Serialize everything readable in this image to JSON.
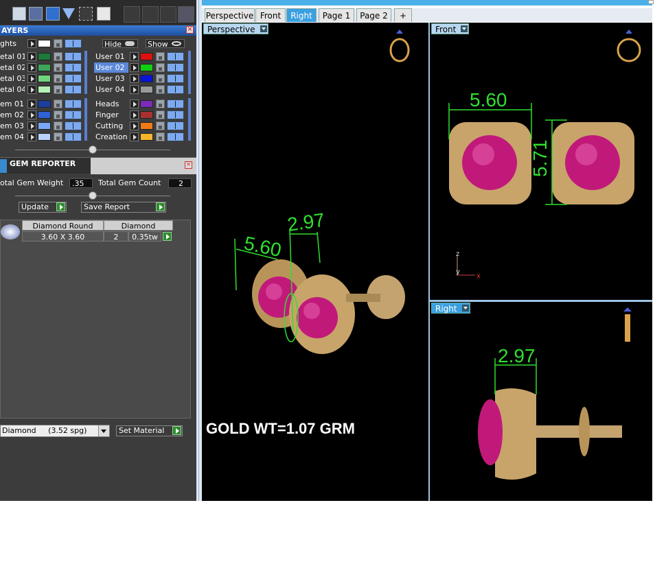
{
  "layers": {
    "title": "AYERS",
    "hide_label": "Hide",
    "show_label": "Show",
    "lights_label": "ghts",
    "left_rows": [
      {
        "name": "etal 01",
        "color": "#1d7a3a"
      },
      {
        "name": "etal 02",
        "color": "#3fa55a"
      },
      {
        "name": "etal 03",
        "color": "#6ed47e"
      },
      {
        "name": "etal 04",
        "color": "#b5f0b5"
      },
      {
        "name": "em 01",
        "color": "#1a3fa0"
      },
      {
        "name": "em 02",
        "color": "#2f62d8"
      },
      {
        "name": "em 03",
        "color": "#78a8f5"
      },
      {
        "name": "em 04",
        "color": "#b9d2fb"
      }
    ],
    "right_rows": [
      {
        "name": "User 01",
        "color": "#e01010"
      },
      {
        "name": "User 02",
        "color": "#10d010",
        "selected": true
      },
      {
        "name": "User 03",
        "color": "#0a14d8"
      },
      {
        "name": "User 04",
        "color": "#9a9a9a"
      },
      {
        "name": "Heads",
        "color": "#7b2bb8"
      },
      {
        "name": "Finger",
        "color": "#a83030"
      },
      {
        "name": "Cutting",
        "color": "#f07a16"
      },
      {
        "name": "Creation",
        "color": "#f5b52a"
      }
    ]
  },
  "gem_reporter": {
    "title": "GEM REPORTER",
    "total_weight_label": "otal Gem Weight",
    "total_weight_value": ".35",
    "total_count_label": "Total Gem Count",
    "total_count_value": "2",
    "update_label": "Update",
    "save_report_label": "Save Report",
    "table_headers": [
      "Diamond Round",
      "Diamond"
    ],
    "row": {
      "size": "3.60 X 3.60",
      "count": "2",
      "weight": "0.35tw"
    },
    "material_select": "Diamond     (3.52 spg)",
    "set_material_label": "Set Material"
  },
  "tabs": [
    "Perspective",
    "Front",
    "Right",
    "Page 1",
    "Page 2",
    "+"
  ],
  "active_tab": "Right",
  "viewports": {
    "perspective_label": "Perspective",
    "front_label": "Front",
    "right_label": "Right"
  },
  "dimensions": {
    "persp_width": "5.60",
    "persp_depth": "2.97",
    "front_width": "5.60",
    "front_height": "5.71",
    "right_depth": "2.97"
  },
  "axis": {
    "z": "z",
    "y": "y",
    "x": "x"
  },
  "gold_weight": "GOLD WT=1.07 GRM",
  "colors": {
    "dim_green": "#2fe02f",
    "gold": "#d9b97a",
    "ruby": "#c1197a",
    "accent_blue": "#3aa0e0"
  }
}
